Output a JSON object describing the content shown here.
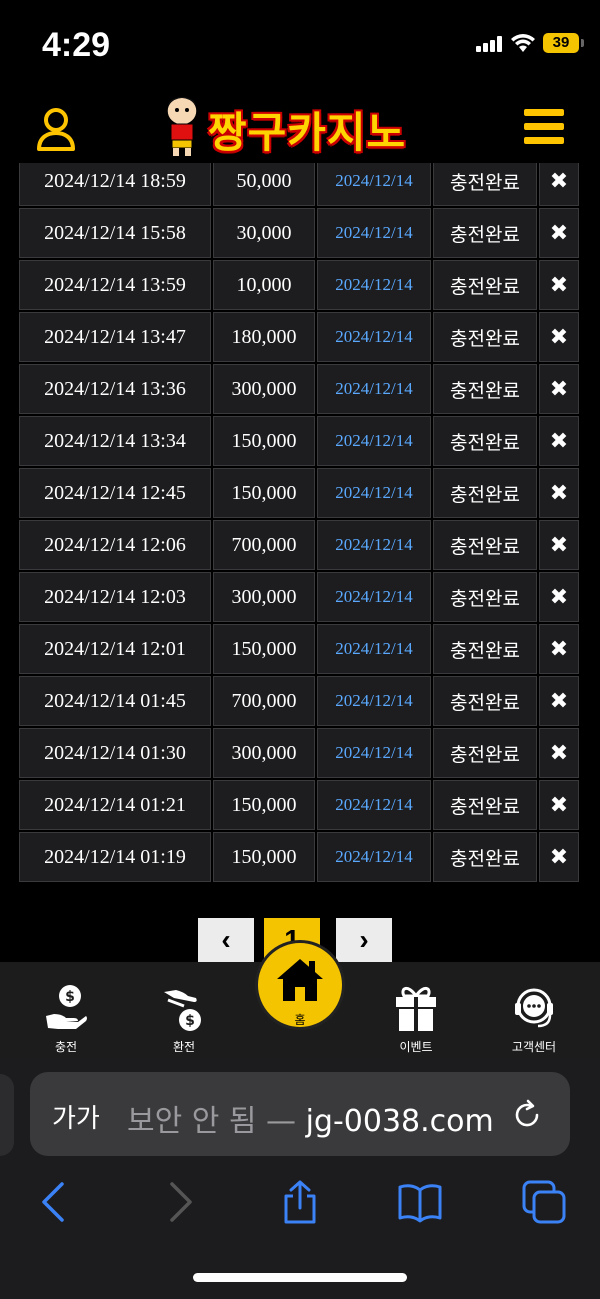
{
  "status": {
    "time": "4:29",
    "battery": "39"
  },
  "header": {
    "logo_text": "짱구카지노"
  },
  "rows": [
    {
      "datetime": "2024/12/14 18:59",
      "amount": "50,000",
      "date": "2024/12/14",
      "status": "충전완료",
      "delete": "✖"
    },
    {
      "datetime": "2024/12/14 15:58",
      "amount": "30,000",
      "date": "2024/12/14",
      "status": "충전완료",
      "delete": "✖"
    },
    {
      "datetime": "2024/12/14 13:59",
      "amount": "10,000",
      "date": "2024/12/14",
      "status": "충전완료",
      "delete": "✖"
    },
    {
      "datetime": "2024/12/14 13:47",
      "amount": "180,000",
      "date": "2024/12/14",
      "status": "충전완료",
      "delete": "✖"
    },
    {
      "datetime": "2024/12/14 13:36",
      "amount": "300,000",
      "date": "2024/12/14",
      "status": "충전완료",
      "delete": "✖"
    },
    {
      "datetime": "2024/12/14 13:34",
      "amount": "150,000",
      "date": "2024/12/14",
      "status": "충전완료",
      "delete": "✖"
    },
    {
      "datetime": "2024/12/14 12:45",
      "amount": "150,000",
      "date": "2024/12/14",
      "status": "충전완료",
      "delete": "✖"
    },
    {
      "datetime": "2024/12/14 12:06",
      "amount": "700,000",
      "date": "2024/12/14",
      "status": "충전완료",
      "delete": "✖"
    },
    {
      "datetime": "2024/12/14 12:03",
      "amount": "300,000",
      "date": "2024/12/14",
      "status": "충전완료",
      "delete": "✖"
    },
    {
      "datetime": "2024/12/14 12:01",
      "amount": "150,000",
      "date": "2024/12/14",
      "status": "충전완료",
      "delete": "✖"
    },
    {
      "datetime": "2024/12/14 01:45",
      "amount": "700,000",
      "date": "2024/12/14",
      "status": "충전완료",
      "delete": "✖"
    },
    {
      "datetime": "2024/12/14 01:30",
      "amount": "300,000",
      "date": "2024/12/14",
      "status": "충전완료",
      "delete": "✖"
    },
    {
      "datetime": "2024/12/14 01:21",
      "amount": "150,000",
      "date": "2024/12/14",
      "status": "충전완료",
      "delete": "✖"
    },
    {
      "datetime": "2024/12/14 01:19",
      "amount": "150,000",
      "date": "2024/12/14",
      "status": "충전완료",
      "delete": "✖"
    }
  ],
  "pagination": {
    "prev": "‹",
    "current": "1",
    "next": "›"
  },
  "bottom_nav": {
    "charge": "충전",
    "exchange": "환전",
    "home": "홈",
    "event": "이벤트",
    "support": "고객센터"
  },
  "browser": {
    "text_size": "가가",
    "security_label": "보안 안 됨 —",
    "domain": "jg-0038.com"
  },
  "colors": {
    "accent": "#f5c400",
    "date_link": "#5aa9ff",
    "cell_bg": "#1d1d1f"
  }
}
